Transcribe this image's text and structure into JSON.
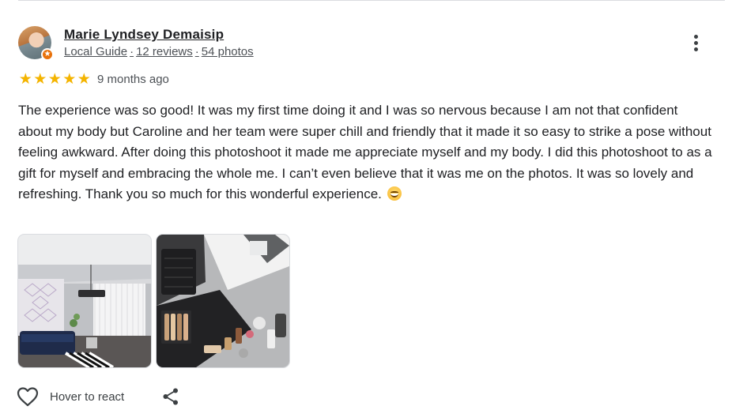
{
  "reviewer": {
    "name": "Marie Lyndsey Demaisip",
    "badge_label": "Local Guide",
    "separator": "·",
    "reviews": "12 reviews",
    "photos": "54 photos"
  },
  "rating": {
    "stars": 5,
    "max": 5
  },
  "time_ago": "9 months ago",
  "review_text": "The experience was so good! It was my first time doing it and I was so nervous because I am not that confident about my body but Caroline and her team were super chill and friendly that it made it so easy to strike a pose without feeling awkward. After doing this photoshoot it made me appreciate myself and my body. I did this photoshoot to as a gift for myself and embracing the whole me. I can’t even believe that it was me on the photos. It was so lovely and refreshing. Thank you so much for this wonderful experience.",
  "actions": {
    "react_label": "Hover to react"
  },
  "icons": {
    "more": "more-vertical-icon",
    "heart": "heart-outline-icon",
    "share": "share-icon",
    "star": "star-icon",
    "emoji": "smiling-face-emoji"
  },
  "colors": {
    "star": "#f4b400",
    "text": "#202124",
    "meta": "#4d5156",
    "badge": "#e8710a"
  }
}
